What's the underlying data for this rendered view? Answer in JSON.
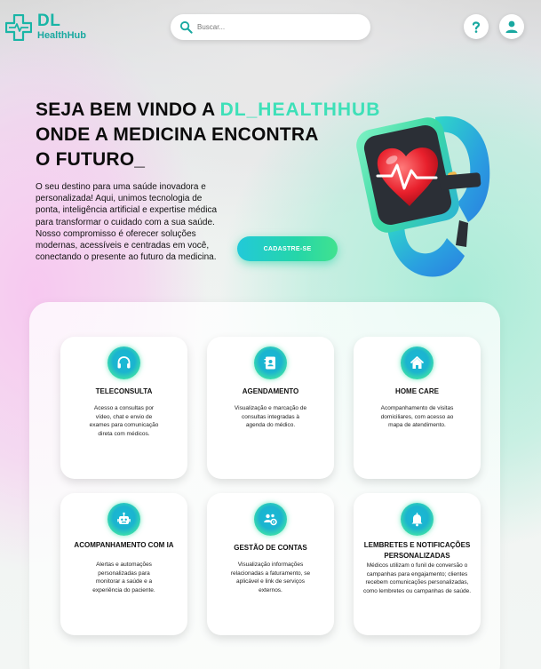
{
  "header": {
    "logo_top": "DL",
    "logo_bottom": "HealthHub",
    "search_placeholder": "Buscar...",
    "icons": [
      "search-icon",
      "help-icon",
      "user-icon"
    ]
  },
  "hero": {
    "title_line1_prefix": "SEJA BEM VINDO A ",
    "title_line1_brand": "DL_HEALTHHUB",
    "title_line2": "ONDE A MEDICINA ENCONTRA",
    "title_line3": "O FUTURO_",
    "text": "O seu destino para uma saúde inovadora e personalizada! Aqui, unimos tecnologia de ponta, inteligência artificial e expertise médica para transformar o cuidado com a sua saúde. Nosso compromisso é oferecer soluções modernas, acessíveis e centradas em você, conectando o presente ao futuro da medicina.",
    "cta_label": "CADASTRE-SE",
    "accent": "#3ee0b8"
  },
  "services": [
    {
      "icon": "headset-icon",
      "title": "TELECONSULTA",
      "desc": "Acesso a consultas por vídeo, chat e envio de exames para comunicação direta com médicos."
    },
    {
      "icon": "contact-book-icon",
      "title": "AGENDAMENTO",
      "desc": "Visualização e marcação de consultas integradas à agenda do médico."
    },
    {
      "icon": "home-icon",
      "title": "HOME CARE",
      "desc": "Acompanhamento de visitas domiciliares, com acesso ao mapa de atendimento."
    },
    {
      "icon": "robot-icon",
      "title": "ACOMPANHAMENTO COM IA",
      "desc": "Alertas e automações personalizadas para monitorar a saúde e a experiência do paciente."
    },
    {
      "icon": "users-gear-icon",
      "title": "GESTÃO DE CONTAS",
      "desc": "Visualização informações relacionadas a faturamento, se aplicável e link de serviços externos."
    },
    {
      "icon": "bell-icon",
      "title": "LEMBRETES E NOTIFICAÇÕES PERSONALIZADAS",
      "desc": "Médicos utilizam o funil de conversão o campanhas para engajamento; clientes recebem comunicações personalizadas, como lembretes ou campanhas de saúde."
    }
  ],
  "colors": {
    "brand": "#19b5a6",
    "cta_start": "#22c9d9",
    "cta_end": "#41e28f"
  }
}
